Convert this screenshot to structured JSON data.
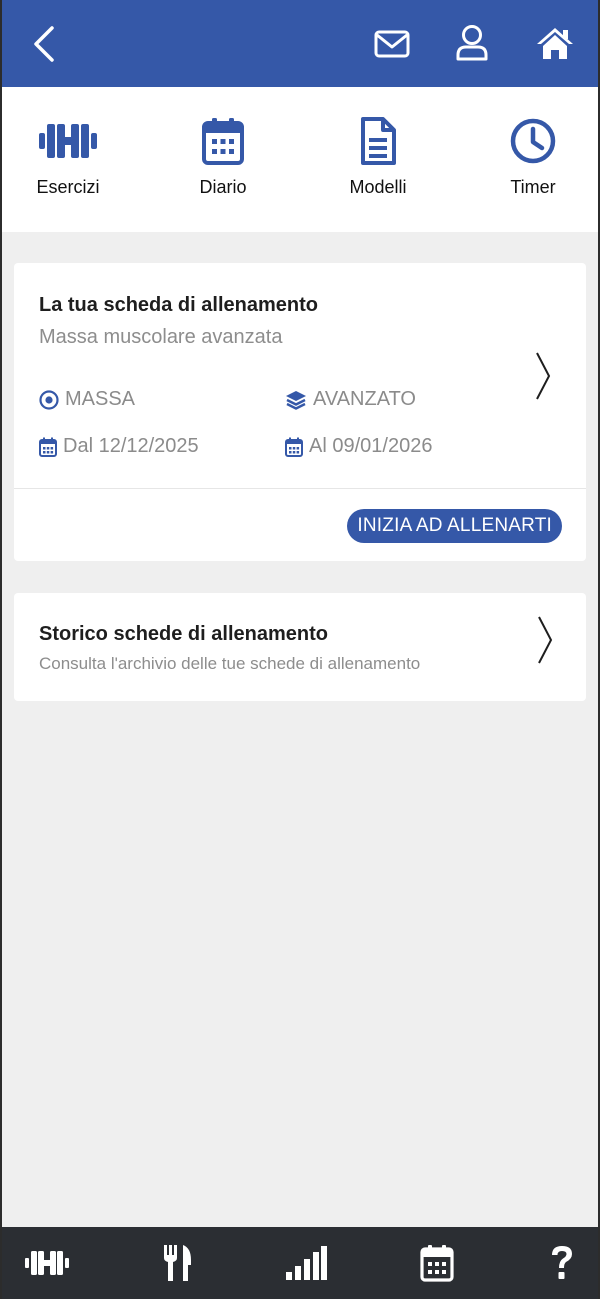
{
  "colors": {
    "primary": "#3558a8",
    "background": "#efefef",
    "bottom_bar": "#2b2e33",
    "muted_text": "#8b8b8b"
  },
  "header": {
    "back_icon": "chevron-left-icon",
    "actions": [
      {
        "icon": "envelope-icon"
      },
      {
        "icon": "user-icon"
      },
      {
        "icon": "home-icon"
      }
    ]
  },
  "shortcuts": [
    {
      "icon": "dumbbell-icon",
      "label": "Esercizi"
    },
    {
      "icon": "calendar-icon",
      "label": "Diario"
    },
    {
      "icon": "document-icon",
      "label": "Modelli"
    },
    {
      "icon": "clock-icon",
      "label": "Timer"
    }
  ],
  "current_plan": {
    "title": "La tua scheda di allenamento",
    "subtitle": "Massa muscolare avanzata",
    "goal": "MASSA",
    "level": "AVANZATO",
    "start_date": "Dal 12/12/2025",
    "end_date": "Al 09/01/2026",
    "start_button": "INIZIA AD ALLENARTI"
  },
  "history": {
    "title": "Storico schede di allenamento",
    "subtitle": "Consulta l'archivio delle tue schede di allenamento"
  },
  "bottom_nav": [
    {
      "icon": "dumbbell-icon"
    },
    {
      "icon": "fork-knife-icon"
    },
    {
      "icon": "signal-bars-icon"
    },
    {
      "icon": "calendar-icon"
    },
    {
      "icon": "question-icon"
    }
  ]
}
